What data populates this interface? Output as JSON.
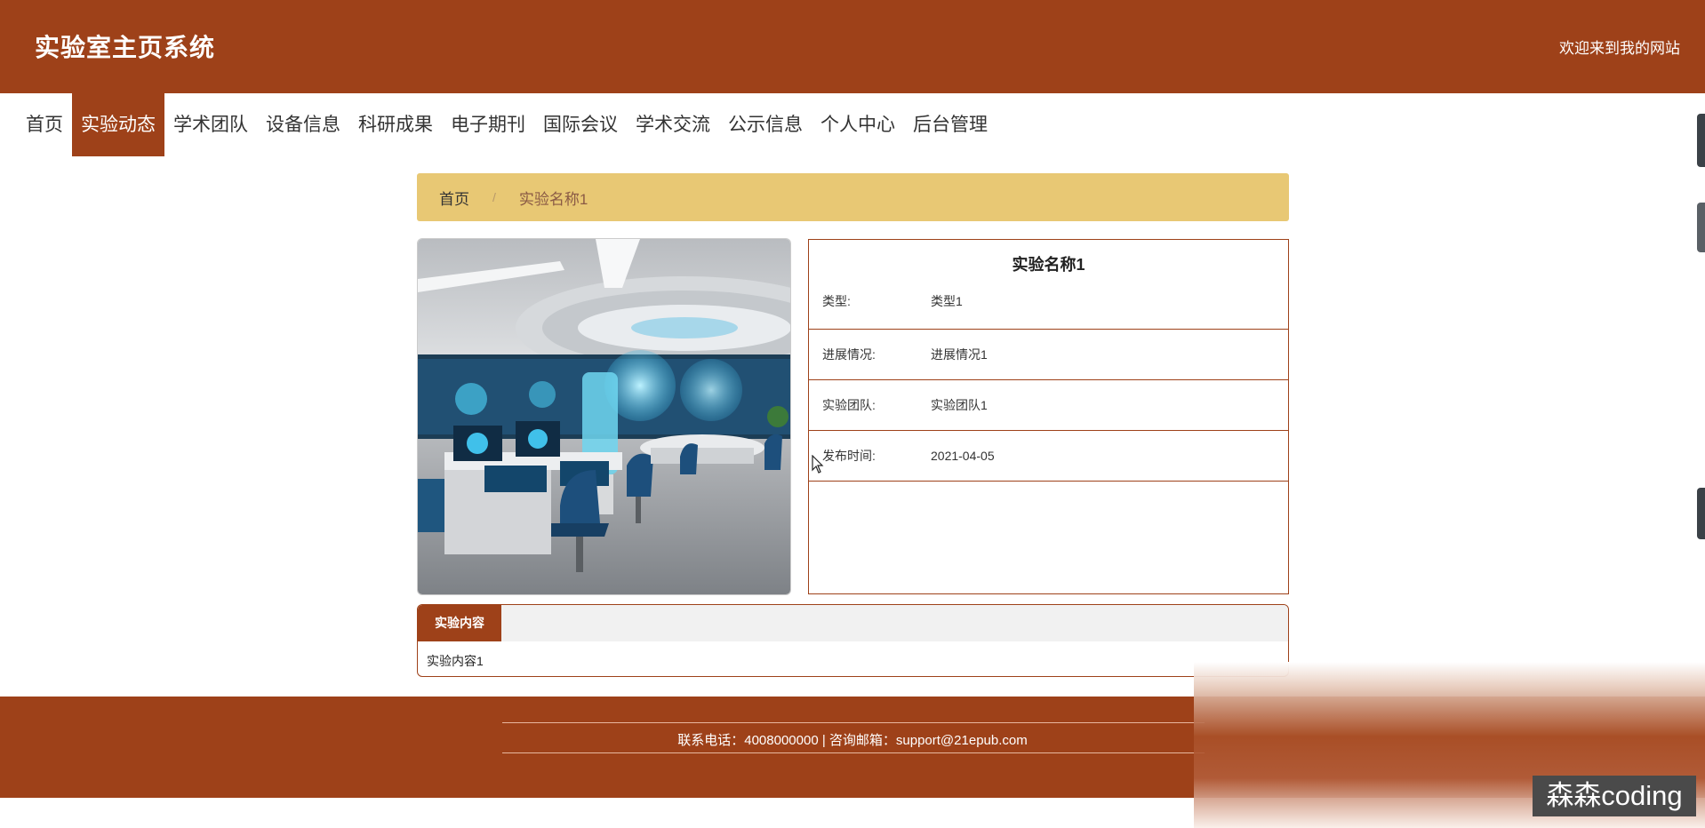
{
  "header": {
    "title": "实验室主页系统",
    "welcome": "欢迎来到我的网站"
  },
  "nav": {
    "items": [
      "首页",
      "实验动态",
      "学术团队",
      "设备信息",
      "科研成果",
      "电子期刊",
      "国际会议",
      "学术交流",
      "公示信息",
      "个人中心",
      "后台管理"
    ],
    "active": "实验动态"
  },
  "breadcrumb": {
    "home": "首页",
    "separator": "/",
    "current": "实验名称1"
  },
  "detail": {
    "title": "实验名称1",
    "fields": [
      {
        "label": "类型:",
        "value": "类型1"
      },
      {
        "label": "进展情况:",
        "value": "进展情况1"
      },
      {
        "label": "实验团队:",
        "value": "实验团队1"
      },
      {
        "label": "发布时间:",
        "value": "2021-04-05"
      }
    ]
  },
  "content": {
    "tab_label": "实验内容",
    "text": "实验内容1"
  },
  "footer": {
    "text": "联系电话：4008000000 | 咨询邮箱：support@21epub.com"
  },
  "watermark": "森森coding",
  "colors": {
    "primary": "#9e4119",
    "breadcrumb_bg": "#e8c874",
    "tab_bar_bg": "#f1f1f1"
  },
  "icons": [
    "lab-photo",
    "mouse-cursor-icon"
  ]
}
